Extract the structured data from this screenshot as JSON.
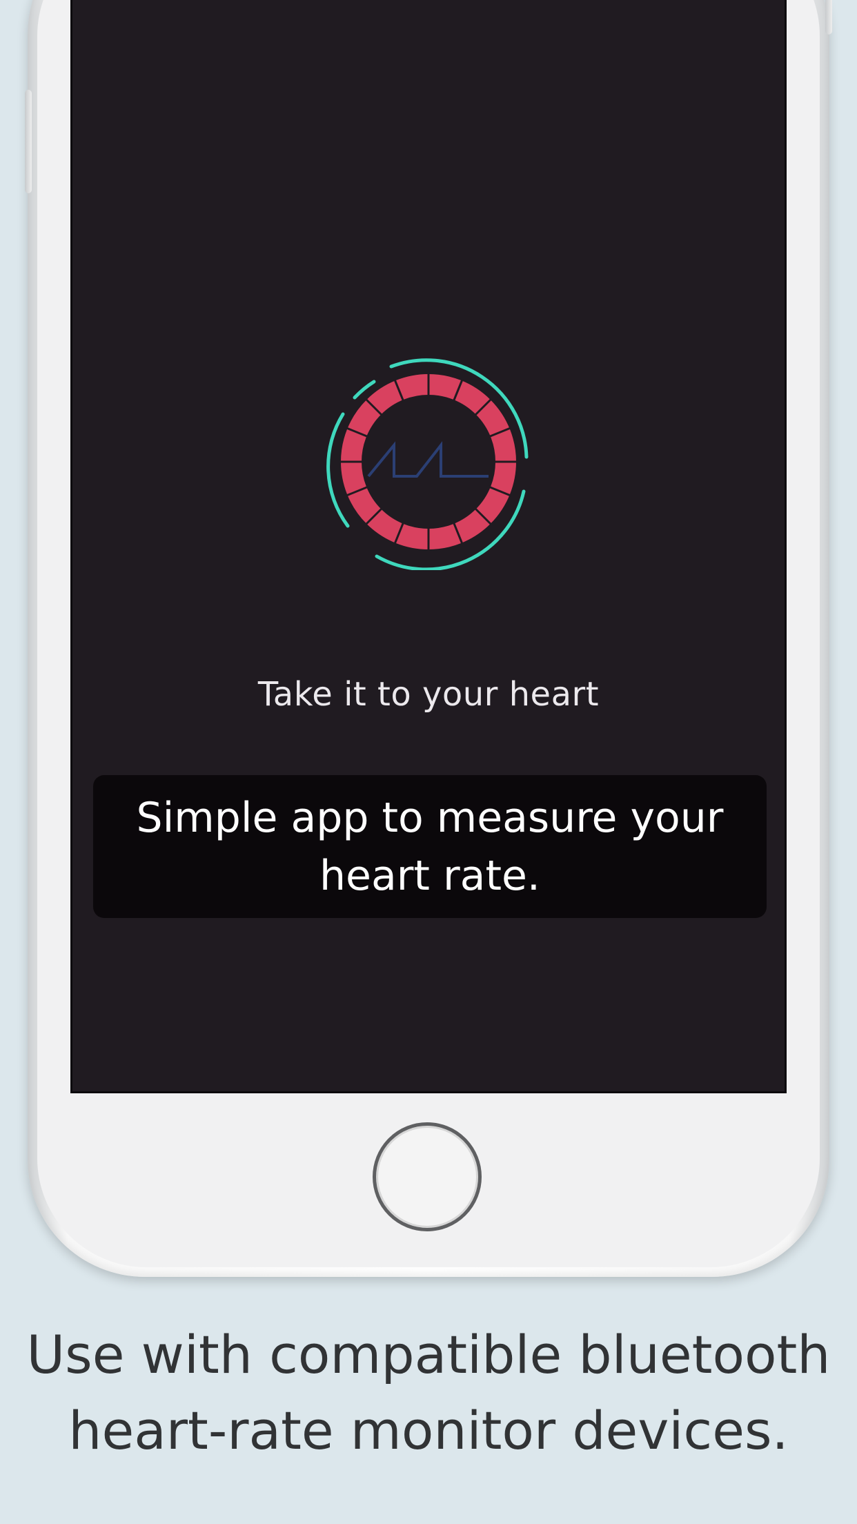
{
  "screen": {
    "tagline": "Take it to your heart",
    "caption": "Simple app to measure your heart rate."
  },
  "promo": {
    "line1": "Use with compatible bluetooth",
    "line2": "heart-rate monitor devices."
  },
  "icons": {
    "logo": "heart-rate-ring-logo",
    "home": "home-button"
  },
  "colors": {
    "background": "#dce7ec",
    "screen": "#201b21",
    "ring_outer": "#3fd8bd",
    "ring_inner": "#d9415f",
    "pulse_line": "#2b3f74"
  }
}
